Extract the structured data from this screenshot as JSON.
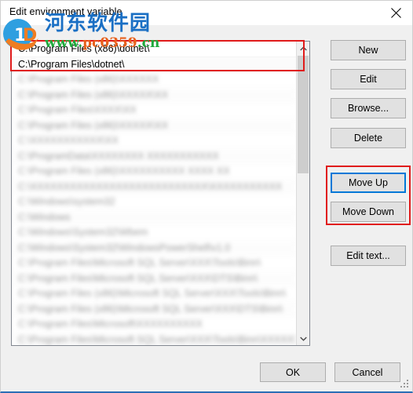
{
  "window": {
    "title": "Edit environment variable",
    "close_icon": "close-icon"
  },
  "path_list": {
    "visible_rows": [
      {
        "text": "C:\\Program Files (x86)\\dotnet\\",
        "blurred": false,
        "selected": false
      },
      {
        "text": "C:\\Program Files\\dotnet\\",
        "blurred": false,
        "selected": false
      },
      {
        "text": "C:\\Program Files (x86)\\XXXXXX",
        "blurred": true,
        "selected": false
      },
      {
        "text": "C:\\Program Files (x86)\\XXXXX\\XX",
        "blurred": true,
        "selected": false
      },
      {
        "text": "C:\\Program Files\\XXXX\\XX",
        "blurred": true,
        "selected": false
      },
      {
        "text": "C:\\Program Files (x86)\\XXXXX\\XX",
        "blurred": true,
        "selected": false
      },
      {
        "text": "C:\\XXXXXXXXXXX\\XX",
        "blurred": true,
        "selected": false
      },
      {
        "text": "C:\\ProgramData\\XXXXXXXX XXXXXXXXXXX",
        "blurred": true,
        "selected": false
      },
      {
        "text": "C:\\Program Files (x86)\\XXXXXXXXXX XXXX XX",
        "blurred": true,
        "selected": false
      },
      {
        "text": "C:\\XXXXXXXXXXXXXXXXXXXXXXXXXXX\\XXXXXXXXXXX",
        "blurred": true,
        "selected": false
      },
      {
        "text": "C:\\Windows\\system32",
        "blurred": true,
        "selected": false
      },
      {
        "text": "C:\\Windows",
        "blurred": true,
        "selected": false
      },
      {
        "text": "C:\\Windows\\System32\\Wbem",
        "blurred": true,
        "selected": false
      },
      {
        "text": "C:\\Windows\\System32\\WindowsPowerShell\\v1.0",
        "blurred": true,
        "selected": false
      },
      {
        "text": "C:\\Program Files\\Microsoft SQL Server\\XXX\\Tools\\Binn\\",
        "blurred": true,
        "selected": false
      },
      {
        "text": "C:\\Program Files\\Microsoft SQL Server\\XXX\\DTS\\Binn\\",
        "blurred": true,
        "selected": false
      },
      {
        "text": "C:\\Program Files (x86)\\Microsoft SQL Server\\XXX\\Tools\\Binn\\",
        "blurred": true,
        "selected": false
      },
      {
        "text": "C:\\Program Files (x86)\\Microsoft SQL Server\\XXX\\DTS\\Binn\\",
        "blurred": true,
        "selected": false
      },
      {
        "text": "C:\\Program Files\\Microsoft\\XXXXXXXXXX",
        "blurred": true,
        "selected": false
      },
      {
        "text": "C:\\Program Files\\Microsoft SQL Server\\XXX\\Tools\\Binn\\XXXXXX",
        "blurred": true,
        "selected": false
      }
    ],
    "scrollbar": {
      "up_arrow": "chevron-up-icon",
      "down_arrow": "chevron-down-icon"
    }
  },
  "side_buttons": {
    "new": "New",
    "edit": "Edit",
    "browse": "Browse...",
    "delete": "Delete",
    "move_up": "Move Up",
    "move_down": "Move Down",
    "edit_text": "Edit text..."
  },
  "footer": {
    "ok": "OK",
    "cancel": "Cancel"
  },
  "watermark": {
    "site_name": "河东软件园",
    "url_prefix": "www.",
    "url_domain": "pc0359",
    "url_suffix": ".cn"
  },
  "colors": {
    "accent_focus": "#0078d7",
    "annotation_red": "#e01b1b",
    "dialog_background": "#f0f0f0",
    "button_face": "#e1e1e1",
    "watermark_blue": "#1a6fc4",
    "watermark_green": "#1faa3c",
    "watermark_orange": "#e8601c"
  }
}
